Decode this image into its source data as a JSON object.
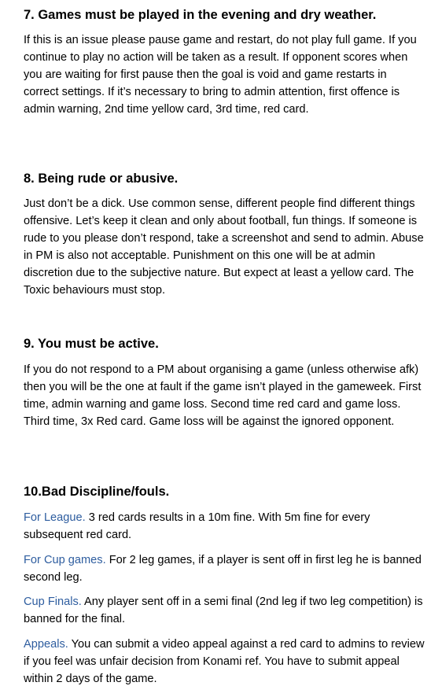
{
  "sections": [
    {
      "heading": "7. Games must be played in the evening and dry weather.",
      "body": "If this is an issue please pause game and restart, do not play full game. If you continue to play no action will be taken as a result. If opponent scores when you are waiting for first pause then the goal is void and game restarts in correct settings. If it’s necessary to bring to admin attention, first offence is admin warning, 2nd time yellow card, 3rd time, red card."
    },
    {
      "heading": "8. Being rude or abusive.",
      "body": "Just don’t be a dick. Use common sense, different people find different things offensive. Let’s keep it clean and only about football, fun things. If someone is rude to you please don’t respond, take a screenshot and send to admin. Abuse in PM is also not acceptable. Punishment on this one will be at admin discretion due to the subjective nature. But expect at least a yellow card. The Toxic behaviours must stop."
    },
    {
      "heading": "9. You must be active.",
      "body": "If you do not respond to a PM about organising a game (unless otherwise afk) then you will be the one at fault if the game isn’t played in the gameweek. First time, admin warning and game loss. Second time red card and game loss. Third time, 3x Red card. Game loss will be against the ignored opponent."
    },
    {
      "heading": "10.Bad Discipline/fouls.",
      "items": [
        {
          "label": "For League.",
          "text": " 3 red cards results in a 10m fine. With 5m fine for every subsequent red card."
        },
        {
          "label": "For Cup games.",
          "text": " For 2 leg games, if a player is sent off in first leg he is banned second leg."
        },
        {
          "label": "Cup Finals.",
          "text": " Any player sent off in a semi final (2nd leg if two leg competition) is banned for the final."
        },
        {
          "label": "Appeals.",
          "text": " You can submit a video appeal against a red card to admins to review if you feel was unfair decision from Konami ref. You have to submit appeal within 2 days of the game."
        }
      ]
    }
  ],
  "colors": {
    "text": "#000000",
    "label_blue": "#2e5d9f",
    "background": "#ffffff"
  }
}
